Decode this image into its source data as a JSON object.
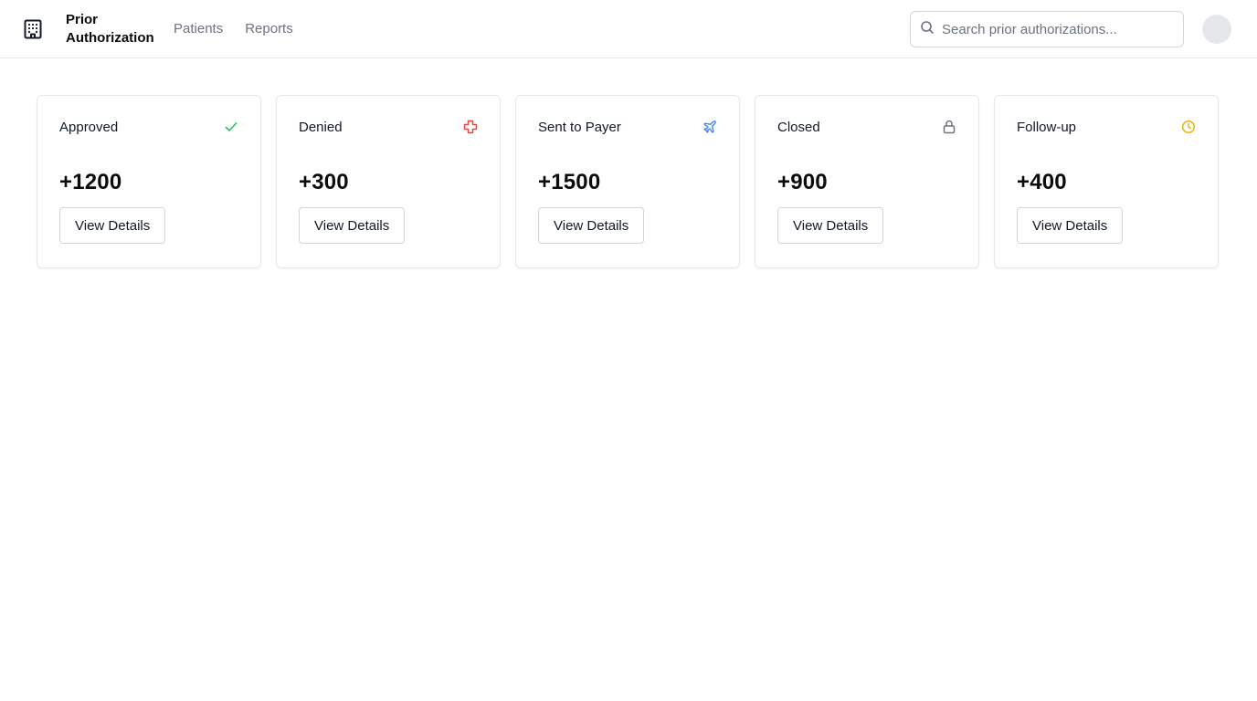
{
  "header": {
    "brand_title": "Prior Authorization",
    "brand_icon": "building-icon",
    "nav": [
      {
        "label": "Patients"
      },
      {
        "label": "Reports"
      }
    ],
    "search": {
      "placeholder": "Search prior authorizations...",
      "value": "",
      "icon": "search-icon"
    },
    "avatar": {
      "icon": "avatar"
    }
  },
  "cards": [
    {
      "title": "Approved",
      "value": "+1200",
      "button": "View Details",
      "icon": "check-icon",
      "icon_color": "#22c55e"
    },
    {
      "title": "Denied",
      "value": "+300",
      "button": "View Details",
      "icon": "cross-icon",
      "icon_color": "#ef4444"
    },
    {
      "title": "Sent to Payer",
      "value": "+1500",
      "button": "View Details",
      "icon": "plane-icon",
      "icon_color": "#3b82f6"
    },
    {
      "title": "Closed",
      "value": "+900",
      "button": "View Details",
      "icon": "lock-icon",
      "icon_color": "#6b7280"
    },
    {
      "title": "Follow-up",
      "value": "+400",
      "button": "View Details",
      "icon": "clock-icon",
      "icon_color": "#eab308"
    }
  ]
}
